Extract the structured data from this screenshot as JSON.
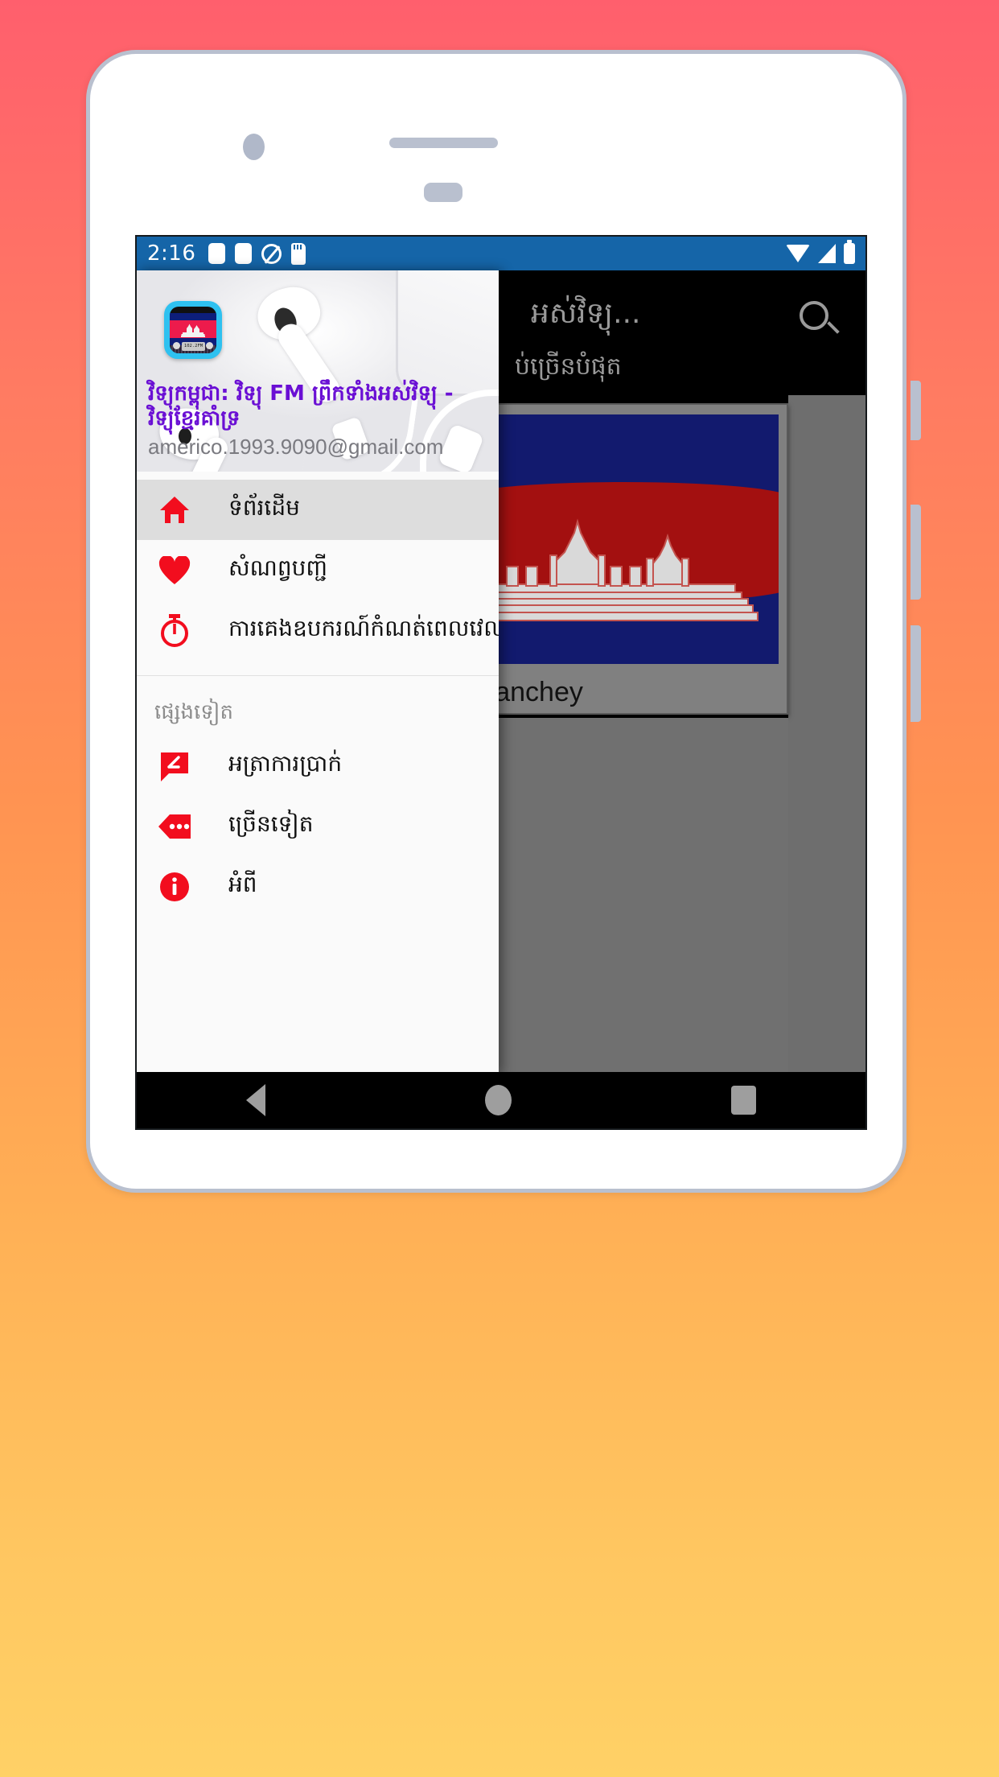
{
  "status_bar": {
    "time": "2:16",
    "left_icons": [
      "sim-card-icon",
      "sim-card-icon",
      "no-sound-icon",
      "sd-card-icon"
    ],
    "right_icons": [
      "wifi-icon",
      "cellular-signal-icon",
      "battery-icon"
    ],
    "background_color": "#1565a8"
  },
  "background_app": {
    "toolbar_title_partial": "អស់វិទ្យុ...",
    "toolbar_subtitle_partial": "ប់ច្រើនបំផុត",
    "search_icon": "search-icon",
    "card": {
      "label_partial": "Meanchey",
      "image_alt": "cambodia-flag"
    }
  },
  "drawer": {
    "header": {
      "app_icon": "radio-cambodia-icon",
      "app_icon_display_text": "102.2FM",
      "title": "វិទ្យុកម្ពុជា: វិទ្យុ FM ព្រឹកទាំងអស់វិទ្យុ - វិទ្យុខ្មែរគាំទ្រ",
      "email": "americo.1993.9090@gmail.com",
      "accent_color": "#6a0fd4"
    },
    "primary_items": [
      {
        "icon": "home-icon",
        "label": "ទំព័រដើម",
        "selected": true
      },
      {
        "icon": "heart-icon",
        "label": "សំណព្វបញ្ជី",
        "selected": false
      },
      {
        "icon": "stopwatch-icon",
        "label": "ការគេងឧបករណ៍កំណត់ពេលវេលា",
        "selected": false
      }
    ],
    "section_header": "ផ្សេងទៀត",
    "secondary_items": [
      {
        "icon": "feedback-icon",
        "label": "អត្រាការប្រាក់",
        "selected": false
      },
      {
        "icon": "more-tag-icon",
        "label": "ច្រើនទៀត",
        "selected": false
      },
      {
        "icon": "info-icon",
        "label": "អំពី",
        "selected": false
      }
    ],
    "icon_color": "#f20d1e"
  },
  "android_navbar": {
    "back": "back-triangle-icon",
    "home": "home-circle-icon",
    "recents": "recents-square-icon"
  },
  "device_frame": {
    "earpiece": "earpiece-speaker",
    "front_camera": "front-camera",
    "sensor": "proximity-sensor",
    "side_buttons": [
      "volume-up-button",
      "volume-down-button",
      "power-button"
    ]
  },
  "page_background": {
    "gradient_start": "#FF5F6D",
    "gradient_end": "#FFD166"
  }
}
